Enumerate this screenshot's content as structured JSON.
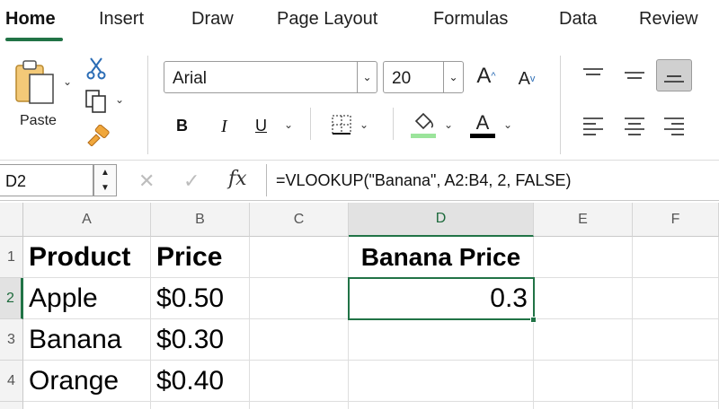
{
  "ribbon_tabs": [
    "Home",
    "Insert",
    "Draw",
    "Page Layout",
    "Formulas",
    "Data",
    "Review"
  ],
  "ribbon": {
    "paste_label": "Paste",
    "font_name": "Arial",
    "font_size": "20",
    "grow_font_label": "A",
    "shrink_font_label": "A",
    "bold_label": "B",
    "italic_label": "I",
    "underline_label": "U",
    "font_color_label": "A",
    "fill_color": "#9be49b",
    "font_color": "#000000",
    "accent_color": "#217346"
  },
  "formula_bar": {
    "name_box": "D2",
    "fx_label": "fx",
    "formula": "=VLOOKUP(\"Banana\", A2:B4, 2, FALSE)"
  },
  "grid": {
    "columns": [
      "A",
      "B",
      "C",
      "D",
      "E",
      "F"
    ],
    "rows": [
      "1",
      "2",
      "3",
      "4"
    ],
    "cells": {
      "A1": "Product",
      "B1": "Price",
      "D1": "Banana Price",
      "A2": "Apple",
      "B2": "$0.50",
      "D2": "0.3",
      "A3": "Banana",
      "B3": "$0.30",
      "A4": "Orange",
      "B4": "$0.40"
    },
    "active_cell": "D2"
  }
}
